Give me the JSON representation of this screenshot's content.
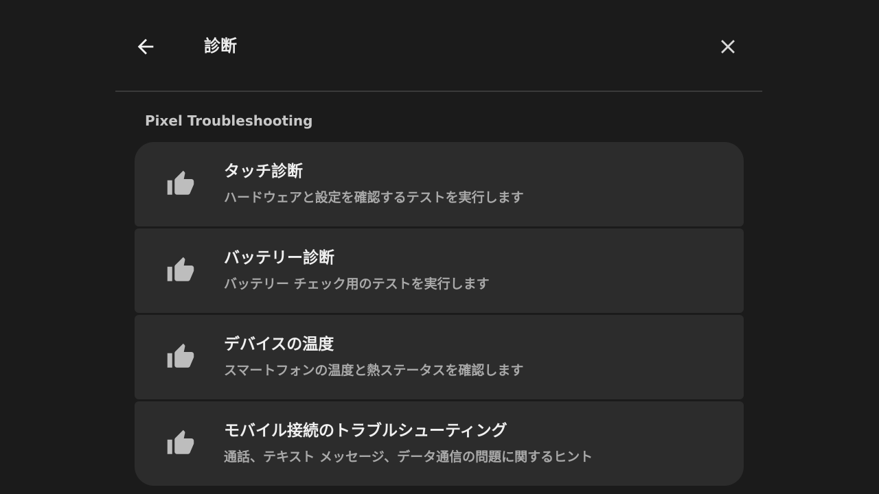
{
  "header": {
    "title": "診断",
    "back_icon": "arrow-back-icon",
    "close_icon": "close-icon"
  },
  "section": {
    "title": "Pixel Troubleshooting"
  },
  "items": [
    {
      "title": "タッチ診断",
      "subtitle": "ハードウェアと設定を確認するテストを実行します",
      "icon": "thumb-up-icon"
    },
    {
      "title": "バッテリー診断",
      "subtitle": "バッテリー チェック用のテストを実行します",
      "icon": "thumb-up-icon"
    },
    {
      "title": "デバイスの温度",
      "subtitle": "スマートフォンの温度と熱ステータスを確認します",
      "icon": "thumb-up-icon"
    },
    {
      "title": "モバイル接続のトラブルシューティング",
      "subtitle": "通話、テキスト メッセージ、データ通信の問題に関するヒント",
      "icon": "thumb-up-icon"
    }
  ],
  "colors": {
    "background": "#1b1b1b",
    "card": "#2c2c2c",
    "divider": "#3a3a3a",
    "icon": "#bdbdbd"
  }
}
